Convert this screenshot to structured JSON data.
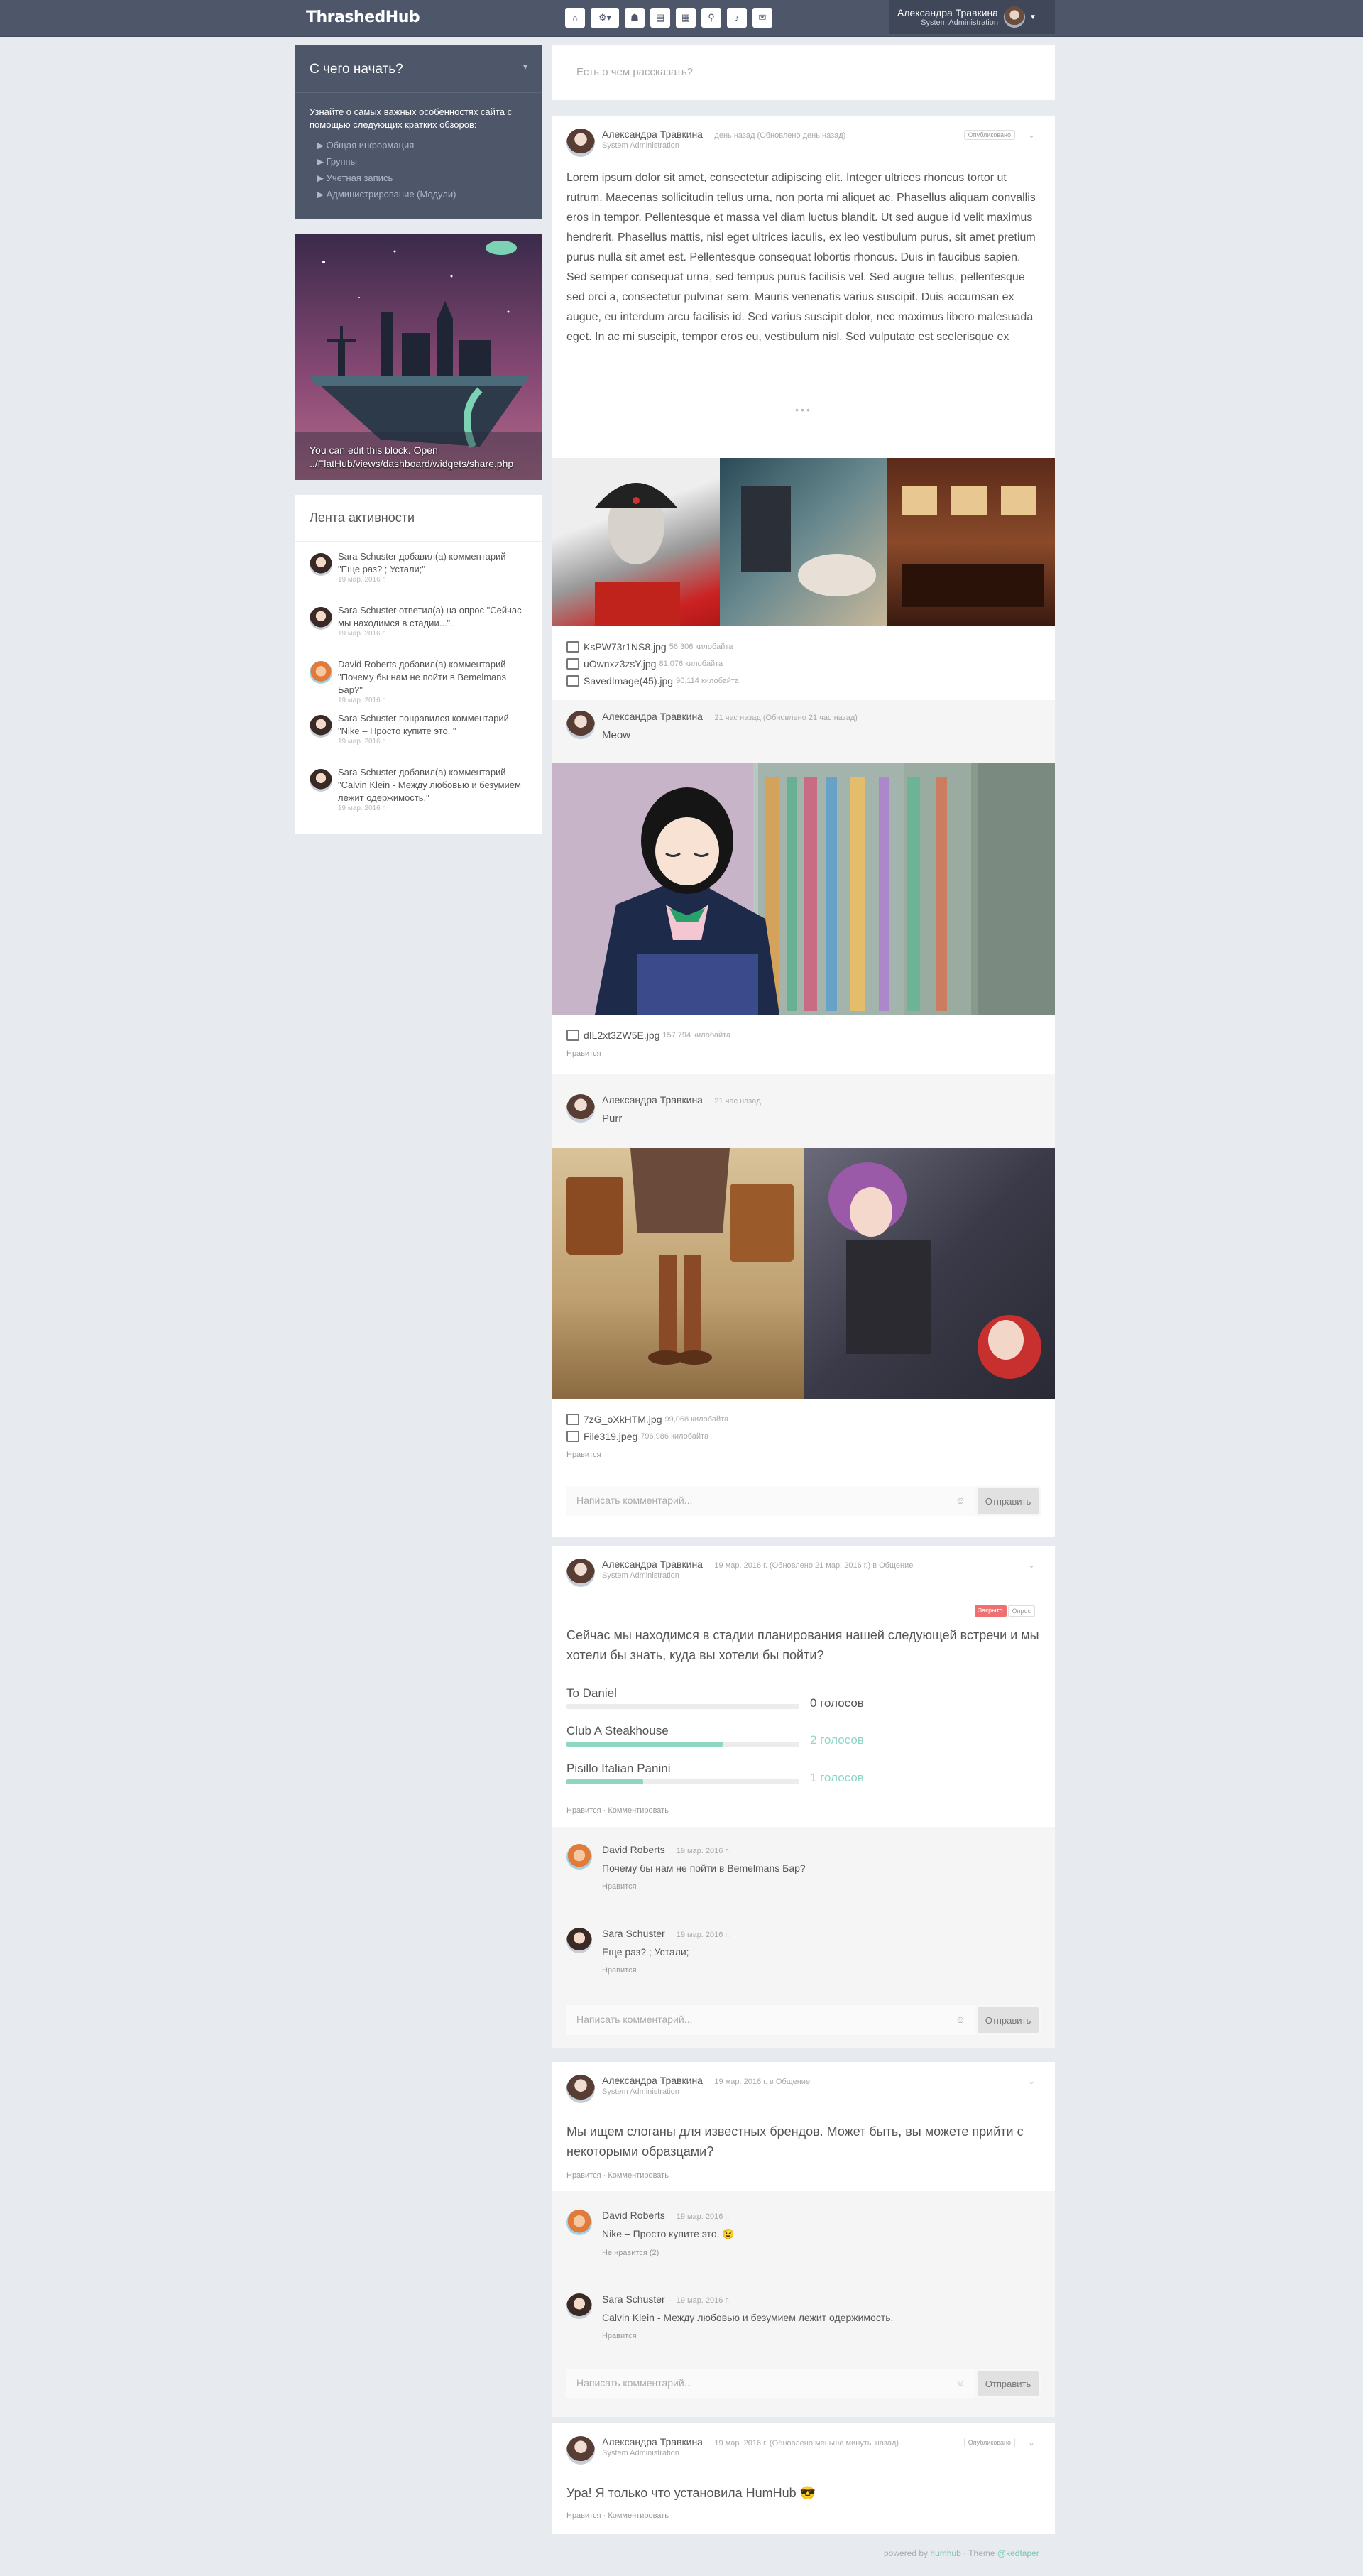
{
  "brand": "ThrashedHub",
  "topnav": [
    "home-icon",
    "dashboard-icon",
    "directory-icon",
    "spaces-icon",
    "files-icon",
    "search-icon",
    "notifications-icon",
    "messages-icon"
  ],
  "user": {
    "name": "Александра Травкина",
    "role": "System Administration"
  },
  "getting_started": {
    "title": "С чего начать?",
    "text": "Узнайте о самых важных особенностях сайта с помощью следующих кратких обзоров:",
    "links": [
      "Общая информация",
      "Группы",
      "Учетная запись",
      "Администрирование (Модули)"
    ]
  },
  "panorama_caption": "You can edit this block. Open ../FlatHub/views/dashboard/widgets/share.php",
  "activity": {
    "title": "Лента активности",
    "items": [
      {
        "text": "Sara Schuster добавил(а) комментарий \"Еще раз? ; Устали;\"",
        "time": "19 мар. 2016 г."
      },
      {
        "text": "Sara Schuster ответил(а) на опрос \"Сейчас мы находимся в стадии...\".",
        "time": "19 мар. 2016 г."
      },
      {
        "text": "David Roberts добавил(а) комментарий \"Почему бы нам не пойти в Bemelmans Бар?\"",
        "time": "19 мар. 2016 г."
      },
      {
        "text": "Sara Schuster понравился комментарий \"Nike – Просто купите это. \"",
        "time": "19 мар. 2016 г."
      },
      {
        "text": "Sara Schuster добавил(а) комментарий \"Calvin Klein - Между любовью и безумием лежит одержимость.\"",
        "time": "19 мар. 2016 г."
      }
    ]
  },
  "new_post_placeholder": "Есть о чем рассказать?",
  "post1": {
    "author": "Александра Травкина",
    "time": "день назад (Обновлено день назад)",
    "role": "System Administration",
    "badge": "Опубликовано",
    "text": "Lorem ipsum dolor sit amet, consectetur adipiscing elit. Integer ultrices rhoncus tortor ut rutrum. Maecenas sollicitudin tellus urna, non porta mi aliquet ac. Phasellus aliquam convallis eros in tempor. Pellentesque et massa vel diam luctus blandit. Ut sed augue id velit maximus hendrerit. Phasellus mattis, nisl eget ultrices iaculis, ex leo vestibulum purus, sit amet pretium purus nulla sit amet est. Pellentesque consequat lobortis rhoncus. Duis in faucibus sapien. Sed semper consequat urna, sed tempus purus facilisis vel. Sed augue tellus, pellentesque sed orci a, consectetur pulvinar sem. Mauris venenatis varius suscipit. Duis accumsan ex augue, eu interdum arcu facilisis id. Sed varius suscipit dolor, nec maximus libero malesuada eget. In ac mi suscipit, tempor eros eu, vestibulum nisl. Sed vulputate est scelerisque ex",
    "more": "•••",
    "files": [
      {
        "name": "KsPW73r1NS8.jpg",
        "size": "56,306 килобайта"
      },
      {
        "name": "uOwnxz3zsY.jpg",
        "size": "81,076 килобайта"
      },
      {
        "name": "SavedImage(45).jpg",
        "size": "90,114 килобайта"
      }
    ]
  },
  "post2": {
    "author": "Александра Травкина",
    "time": "21 час назад (Обновлено 21 час назад)",
    "text": "Meow",
    "files": [
      {
        "name": "dIL2xt3ZW5E.jpg",
        "size": "157,794 килобайта"
      }
    ],
    "like": "Нравится"
  },
  "post3": {
    "author": "Александра Травкина",
    "time": "21 час назад",
    "text": "Purr",
    "files": [
      {
        "name": "7zG_oXkHTM.jpg",
        "size": "99,068 килобайта"
      },
      {
        "name": "File319.jpeg",
        "size": "796,986 килобайта"
      }
    ],
    "like": "Нравится",
    "comment_placeholder": "Написать комментарий...",
    "submit": "Отправить"
  },
  "poll": {
    "author": "Александра Травкина",
    "time": "19 мар. 2016 г. (Обновлено 21 мар. 2016 г.) в Общение",
    "role": "System Administration",
    "tags": [
      "Закрыто",
      "Опрос"
    ],
    "question": "Сейчас мы находимся в стадии планирования нашей следующей встречи и мы хотели бы знать, куда вы хотели бы пойти?",
    "options": [
      {
        "label": "To Daniel",
        "votes": "0 голосов",
        "fraction": 0
      },
      {
        "label": "Club A Steakhouse",
        "votes": "2 голосов",
        "fraction": 0.67
      },
      {
        "label": "Pisillo Italian Panini",
        "votes": "1 голосов",
        "fraction": 0.33
      }
    ],
    "actions": "Нравится · Комментировать",
    "comments": [
      {
        "name": "David Roberts",
        "time": "19 мар. 2016 г.",
        "text": "Почему бы нам не пойти в Bemelmans Бар?",
        "like": "Нравится"
      },
      {
        "name": "Sara Schuster",
        "time": "19 мар. 2016 г.",
        "text": "Еще раз? ; Устали;",
        "like": "Нравится"
      }
    ],
    "comment_placeholder": "Написать комментарий...",
    "submit": "Отправить"
  },
  "slogan": {
    "author": "Александра Травкина",
    "time": "19 мар. 2016 г. в Общение",
    "role": "System Administration",
    "text": "Мы ищем слоганы для известных брендов. Может быть, вы можете прийти с некоторыми образцами?",
    "actions": "Нравится · Комментировать",
    "comments": [
      {
        "name": "David Roberts",
        "time": "19 мар. 2016 г.",
        "text": "Nike – Просто купите это. 😉",
        "like": "Не нравится (2)"
      },
      {
        "name": "Sara Schuster",
        "time": "19 мар. 2016 г.",
        "text": "Calvin Klein - Между любовью и безумием лежит одержимость.",
        "like": "Нравится"
      }
    ],
    "comment_placeholder": "Написать комментарий...",
    "submit": "Отправить"
  },
  "humhub": {
    "author": "Александра Травкина",
    "time": "19 мар. 2016 г. (Обновлено меньше минуты назад)",
    "role": "System Administration",
    "badge": "Опубликовано",
    "text": "Ура! Я только что установила HumHub 😎",
    "actions": "Нравится · Комментировать"
  },
  "footer": {
    "powered": "powered by",
    "humhub": "humhub",
    "theme": "Theme",
    "dev": "@kedtaper"
  }
}
